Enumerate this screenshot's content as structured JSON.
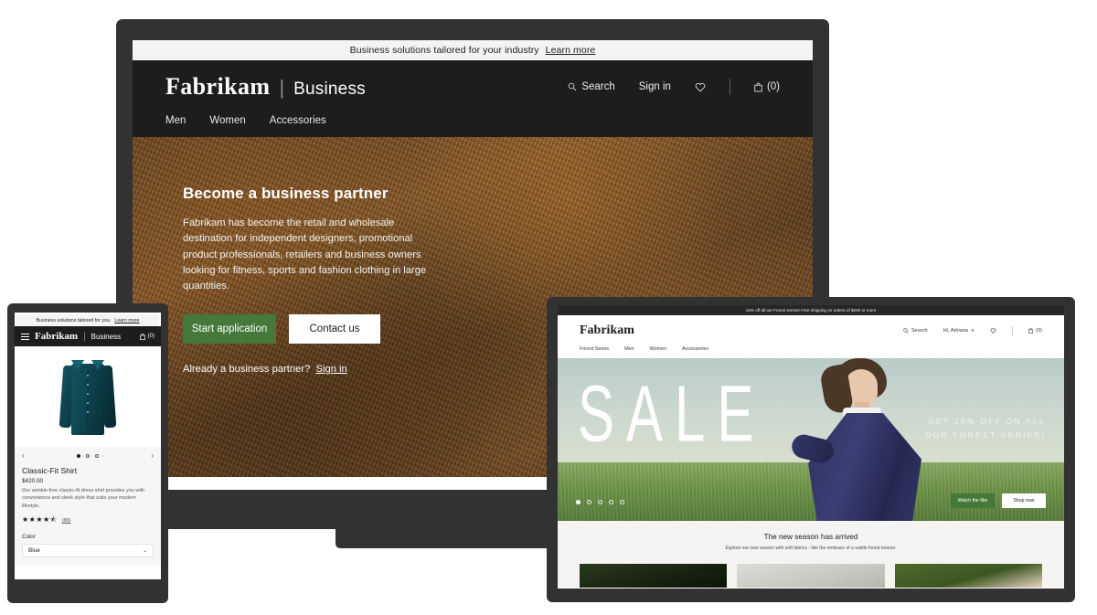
{
  "laptop": {
    "promo": {
      "text": "Business solutions tailored for your industry",
      "link": "Learn more"
    },
    "brand": {
      "name": "Fabrikam",
      "divider": "|",
      "sub": "Business"
    },
    "header_actions": {
      "search": "Search",
      "signin": "Sign in",
      "wishlist_icon": "heart-icon",
      "bag": "(0)"
    },
    "nav": [
      "Men",
      "Women",
      "Accessories"
    ],
    "hero": {
      "title": "Become a business partner",
      "body": "Fabrikam has become the retail and wholesale destination for independent designers, promotional product professionals, retailers and business owners looking for fitness, sports and fashion clothing in large quantities.",
      "primary_button": "Start application",
      "secondary_button": "Contact us",
      "note": "Already a business partner?",
      "note_link": "Sign in"
    }
  },
  "phone": {
    "promo": {
      "text": "Business solutions tailored for you.",
      "link": "Learn more"
    },
    "brand": {
      "name": "Fabrikam",
      "divider": "|",
      "sub": "Business"
    },
    "bag": "(0)",
    "carousel": {
      "prev": "‹",
      "next": "›",
      "dots": 3,
      "active": 0
    },
    "product": {
      "title": "Classic-Fit Shirt",
      "price": "$420.00",
      "description": "Our wrinkle-free classic-fit dress shirt provides you with convenience and sleek style that suits your modern lifestyle.",
      "stars": "★★★★⯪",
      "review_count": "(88)",
      "color_label": "Color",
      "color_value": "Blue",
      "chevron": "⌄"
    }
  },
  "tablet": {
    "promo": "15% off all our Forest Series! Free shipping on orders of $200 or more",
    "brand": "Fabrikam",
    "header_actions": {
      "search": "Search",
      "account": "Hi, Adriana",
      "account_chevron": "∨",
      "wishlist_icon": "heart-icon",
      "bag": "(0)"
    },
    "nav": [
      "Forest Series",
      "Men",
      "Women",
      "Accessories"
    ],
    "hero": {
      "sale_word": "SALE",
      "promo_line1": "GET 15% OFF ON ALL",
      "promo_line2": "OUR FOREST SERIES!",
      "primary_button": "Watch the film",
      "secondary_button": "Shop now",
      "dots": 5,
      "active": 0
    },
    "season": {
      "title": "The new season has arrived",
      "subtitle": "Explore our new season with soft fabrics - like the embrace of a subtle forest breeze."
    }
  },
  "colors": {
    "accent_green": "#44793a",
    "dark": "#1d1d1d",
    "bezel": "#323232",
    "light_bg": "#f5f4f2"
  }
}
